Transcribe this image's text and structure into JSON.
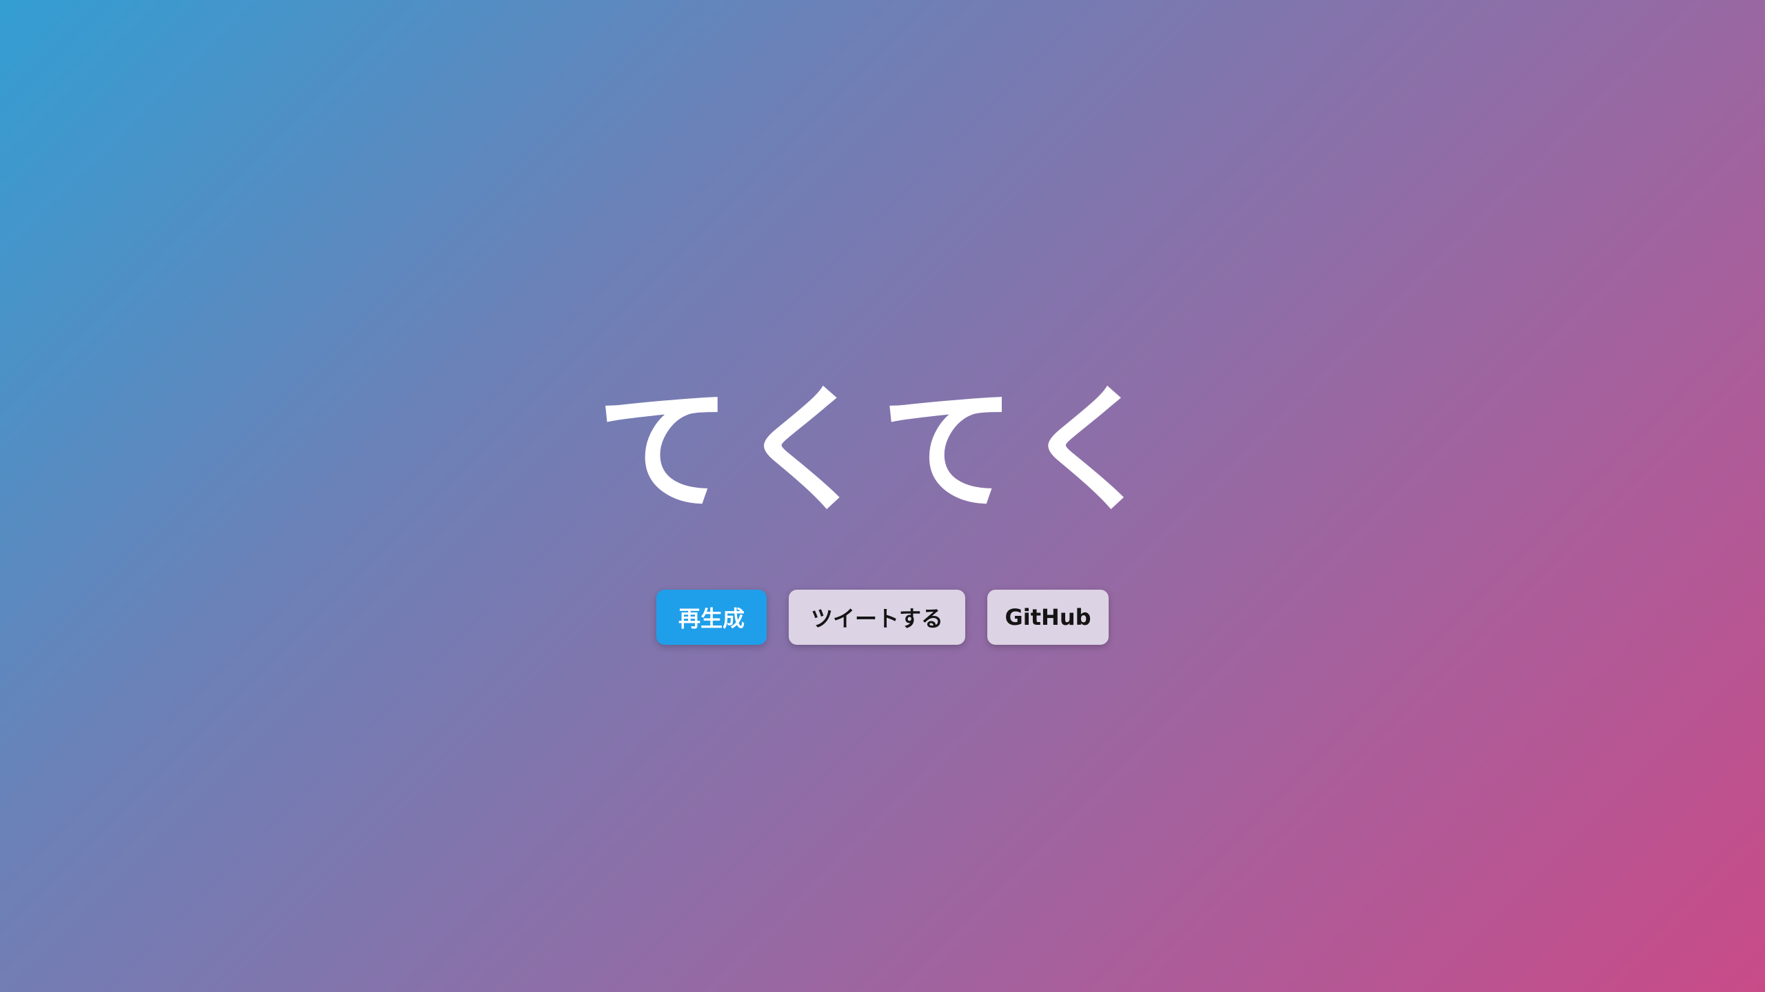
{
  "title": "てくてく",
  "buttons": {
    "regenerate_label": "再生成",
    "tweet_label": "ツイートする",
    "github_label": "GitHub"
  },
  "colors": {
    "background_start": "#339ed3",
    "background_end": "#c84b88",
    "primary_button": "#1f9fea",
    "secondary_button": "#dcd3e4",
    "title_text": "#ffffff"
  }
}
